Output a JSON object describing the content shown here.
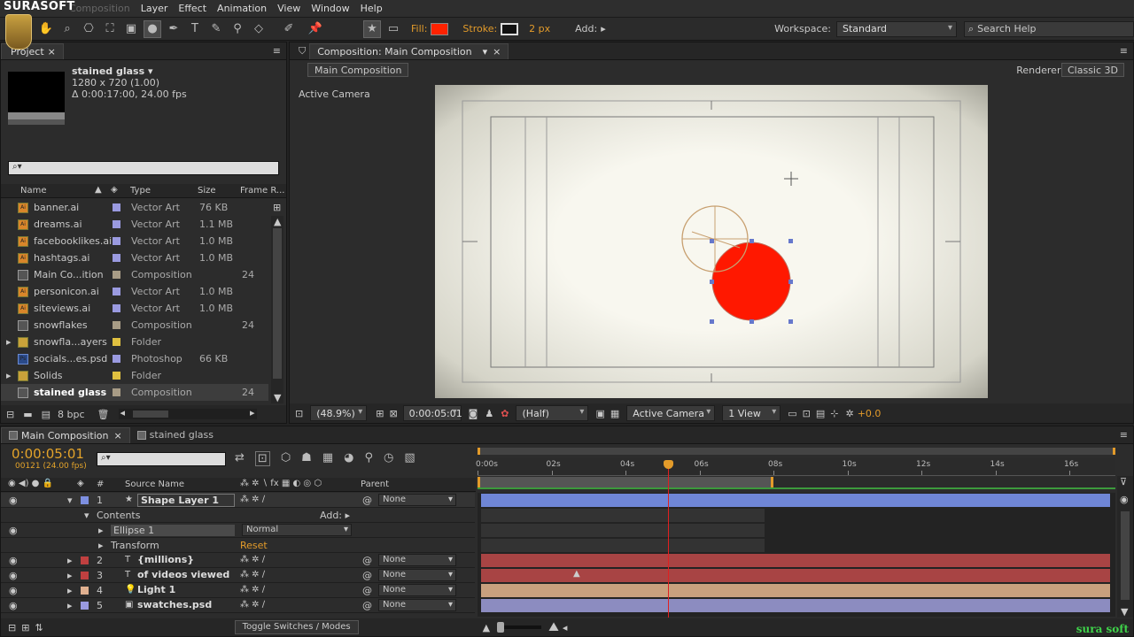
{
  "brand": "SURASOFT",
  "menu": [
    "Composition",
    "Layer",
    "Effect",
    "Animation",
    "View",
    "Window",
    "Help"
  ],
  "toolbar": {
    "fill_label": "Fill:",
    "fill_color": "#ff2200",
    "stroke_label": "Stroke:",
    "stroke_width": "2 px",
    "add_label": "Add:",
    "workspace_label": "Workspace:",
    "workspace_value": "Standard",
    "search_placeholder": "Search Help"
  },
  "project": {
    "tab": "Project",
    "item_name": "stained glass ▾",
    "item_dims": "1280 x 720 (1.00)",
    "item_duration": "Δ 0:00:17:00, 24.00 fps",
    "search_placeholder": "",
    "columns": [
      "Name",
      "Type",
      "Size",
      "Frame R..."
    ],
    "items": [
      {
        "name": "banner.ai",
        "type": "Vector Art",
        "size": "76 KB",
        "frame": "",
        "icon": "ai",
        "label": "#9a9ae0"
      },
      {
        "name": "dreams.ai",
        "type": "Vector Art",
        "size": "1.1 MB",
        "frame": "",
        "icon": "ai",
        "label": "#9a9ae0"
      },
      {
        "name": "facebooklikes.ai",
        "type": "Vector Art",
        "size": "1.0 MB",
        "frame": "",
        "icon": "ai",
        "label": "#9a9ae0"
      },
      {
        "name": "hashtags.ai",
        "type": "Vector Art",
        "size": "1.0 MB",
        "frame": "",
        "icon": "ai",
        "label": "#9a9ae0"
      },
      {
        "name": "Main Co...ition",
        "type": "Composition",
        "size": "",
        "frame": "24",
        "icon": "comp",
        "label": "#a89c86"
      },
      {
        "name": "personicon.ai",
        "type": "Vector Art",
        "size": "1.0 MB",
        "frame": "",
        "icon": "ai",
        "label": "#9a9ae0"
      },
      {
        "name": "siteviews.ai",
        "type": "Vector Art",
        "size": "1.0 MB",
        "frame": "",
        "icon": "ai",
        "label": "#9a9ae0"
      },
      {
        "name": "snowflakes",
        "type": "Composition",
        "size": "",
        "frame": "24",
        "icon": "comp",
        "label": "#a89c86"
      },
      {
        "name": "snowfla...ayers",
        "type": "Folder",
        "size": "",
        "frame": "",
        "icon": "folder",
        "label": "#e0c040"
      },
      {
        "name": "socials...es.psd",
        "type": "Photoshop",
        "size": "66 KB",
        "frame": "",
        "icon": "ps",
        "label": "#9a9ae0"
      },
      {
        "name": "Solids",
        "type": "Folder",
        "size": "",
        "frame": "",
        "icon": "folder",
        "label": "#e0c040"
      },
      {
        "name": "stained glass",
        "type": "Composition",
        "size": "",
        "frame": "24",
        "icon": "comp",
        "label": "#a89c86"
      }
    ],
    "bpc": "8 bpc"
  },
  "composition": {
    "tab": "Composition: Main Composition",
    "subtab": "Main Composition",
    "renderer_label": "Renderer:",
    "renderer_value": "Classic 3D",
    "view_label": "Active Camera",
    "zoom": "(48.9%)",
    "timecode": "0:00:05:01",
    "resolution": "(Half)",
    "camera": "Active Camera",
    "views": "1 View",
    "exposure": "+0.0"
  },
  "timeline": {
    "tabs": [
      "Main Composition",
      "stained glass"
    ],
    "timecode": "0:00:05:01",
    "frames": "00121 (24.00 fps)",
    "col_source": "Source Name",
    "col_parent": "Parent",
    "ruler": [
      "0:00s",
      "02s",
      "04s",
      "06s",
      "08s",
      "10s",
      "12s",
      "14s",
      "16s"
    ],
    "layers": [
      {
        "num": "1",
        "name": "Shape Layer 1",
        "parent": "None",
        "color": "#7d8fe0",
        "bar": "#6f86d6"
      },
      {
        "num": "",
        "name": "Contents",
        "add": "Add:",
        "sub": true
      },
      {
        "num": "",
        "name": "Ellipse 1",
        "mode": "Normal",
        "sub": true
      },
      {
        "num": "",
        "name": "Transform",
        "reset": "Reset",
        "sub": true
      },
      {
        "num": "2",
        "name": "{millions}",
        "parent": "None",
        "color": "#c04040",
        "bar": "#a84444"
      },
      {
        "num": "3",
        "name": "of videos viewed",
        "parent": "None",
        "color": "#c04040",
        "bar": "#a84444"
      },
      {
        "num": "4",
        "name": "Light 1",
        "parent": "None",
        "color": "#e0b090",
        "bar": "#c8a07e"
      },
      {
        "num": "5",
        "name": "swatches.psd",
        "parent": "None",
        "color": "#9a9ae0",
        "bar": "#8c8cc0"
      }
    ],
    "toggle": "Toggle Switches / Modes"
  },
  "watermark": "sura soft"
}
